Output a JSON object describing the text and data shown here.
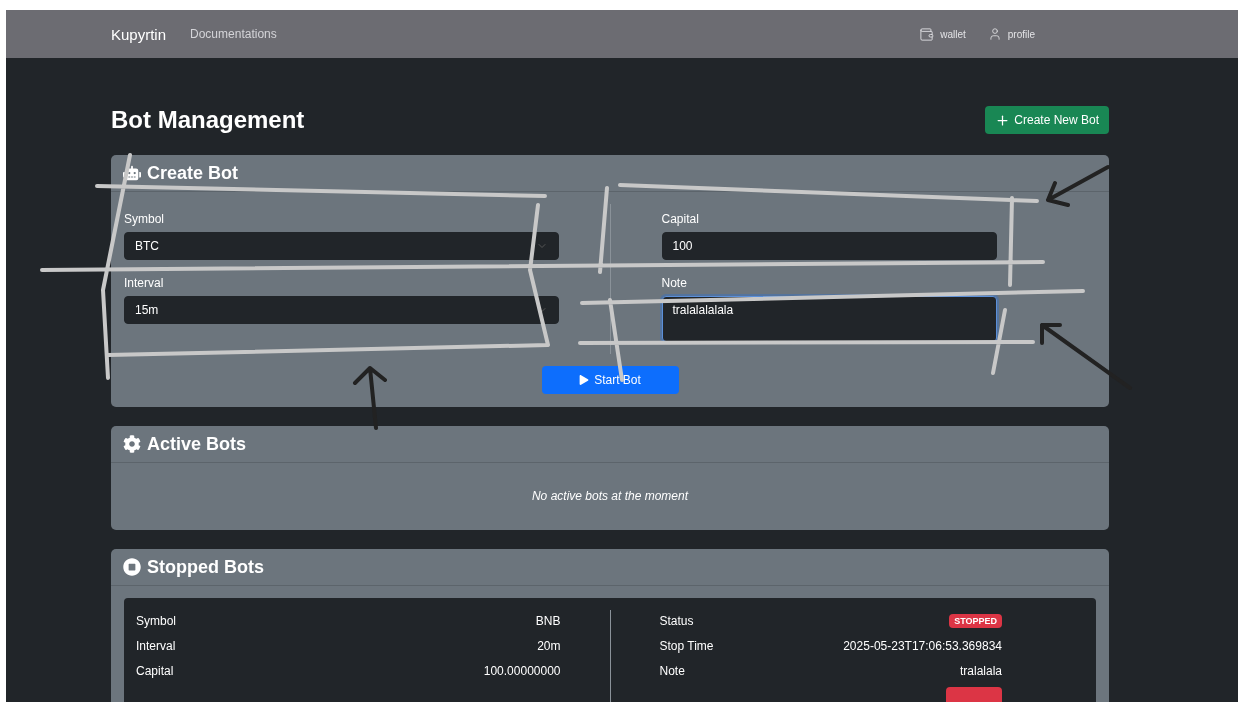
{
  "navbar": {
    "brand": "Kupyrtin",
    "links": [
      "Documentations"
    ],
    "right_items": [
      {
        "kind": "wallet",
        "label": "wallet"
      },
      {
        "kind": "profile",
        "label": "profile"
      }
    ]
  },
  "page": {
    "title": "Bot Management",
    "create_button": "Create New Bot"
  },
  "create_bot": {
    "title": "Create Bot",
    "left_fields": [
      {
        "kind": "select",
        "label": "Symbol",
        "value": "BTC",
        "focused": false
      },
      {
        "kind": "select",
        "label": "Interval",
        "value": "15m",
        "focused": false
      }
    ],
    "right_fields": [
      {
        "kind": "input",
        "label": "Capital",
        "value": "100",
        "focused": false
      },
      {
        "kind": "textarea",
        "label": "Note",
        "value": "tralalalalala",
        "focused": true
      }
    ],
    "start_button": "Start Bot"
  },
  "active_bots": {
    "title": "Active Bots",
    "empty_message": "No active bots at the moment"
  },
  "stopped_bots": {
    "title": "Stopped Bots",
    "bots": [
      {
        "left_rows": [
          {
            "label": "Symbol",
            "value": "BNB"
          },
          {
            "label": "Interval",
            "value": "20m"
          },
          {
            "label": "Capital",
            "value": "100.00000000"
          }
        ],
        "right_rows": [
          {
            "label": "Status",
            "value": "STOPPED",
            "kind": "badge"
          },
          {
            "label": "Stop Time",
            "value": "2025-05-23T17:06:53.369834",
            "kind": "text"
          },
          {
            "label": "Note",
            "value": "tralalala",
            "kind": "text"
          }
        ]
      }
    ]
  }
}
